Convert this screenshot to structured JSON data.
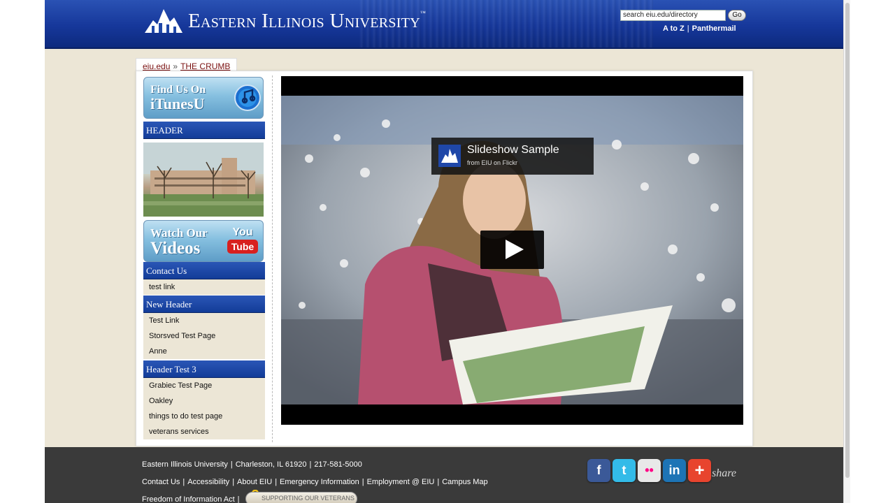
{
  "header": {
    "university_name": "Eastern Illinois University",
    "trademark": "™",
    "search_value": "search eiu.edu/directory",
    "go_label": "Go",
    "links": [
      "A to Z",
      "Panthermail"
    ]
  },
  "breadcrumb": {
    "home": "eiu.edu",
    "separator": "»",
    "current": "THE CRUMB"
  },
  "sidebar": {
    "itunes_promo": {
      "line1": "Find Us On",
      "line2": "iTunesU"
    },
    "header1": "HEADER",
    "video_promo": {
      "line1": "Watch Our",
      "line2": "Videos",
      "badge_top": "You",
      "badge_bottom": "Tube"
    },
    "sections": [
      {
        "title": "Contact Us",
        "items": [
          "test link"
        ]
      },
      {
        "title": "New Header",
        "items": [
          "Test Link",
          "Storsved Test Page",
          "Anne"
        ]
      },
      {
        "title": "Header Test 3",
        "items": [
          "Grabiec Test Page",
          "Oakley",
          "things to do test page",
          "veterans services"
        ]
      }
    ]
  },
  "video": {
    "title": "Slideshow Sample",
    "subtitle": "from EIU on Flickr"
  },
  "footer": {
    "address_line": [
      "Eastern Illinois University",
      "Charleston, IL 61920",
      "217-581-5000"
    ],
    "links": [
      "Contact Us",
      "Accessibility",
      "About EIU",
      "Emergency Information",
      "Employment @ EIU",
      "Campus Map"
    ],
    "foia": "Freedom of Information Act",
    "veterans_badge": "SUPPORTING OUR VETERANS",
    "share_label": "share",
    "social": [
      {
        "name": "facebook",
        "glyph": "f",
        "color": "#3b5998"
      },
      {
        "name": "twitter",
        "glyph": "t",
        "color": "#33bbe8"
      },
      {
        "name": "flickr",
        "glyph": "••",
        "color": "#e8e8e8"
      },
      {
        "name": "linkedin",
        "glyph": "in",
        "color": "#1d74b5"
      },
      {
        "name": "addthis",
        "glyph": "+",
        "color": "#e8442e"
      }
    ]
  }
}
